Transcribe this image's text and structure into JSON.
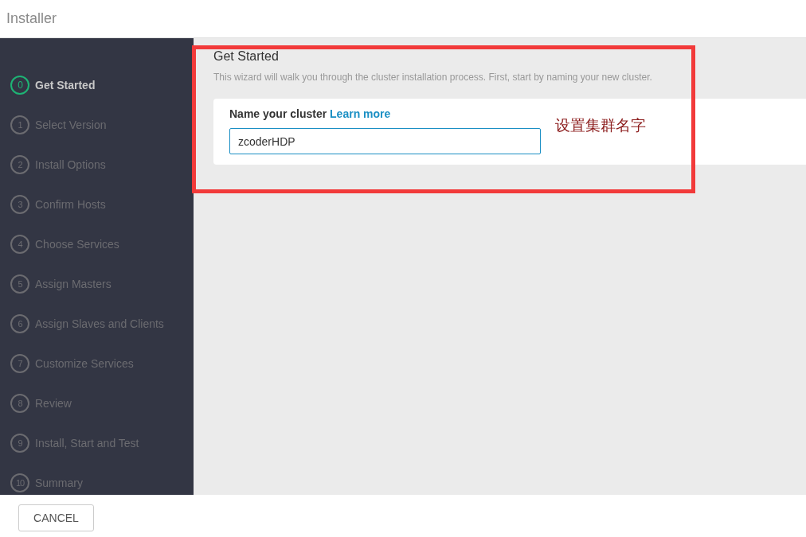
{
  "window": {
    "title": "Installer"
  },
  "steps": [
    {
      "number": "0",
      "label": "Get Started",
      "selected": true
    },
    {
      "number": "1",
      "label": "Select Version",
      "selected": false
    },
    {
      "number": "2",
      "label": "Install Options",
      "selected": false
    },
    {
      "number": "3",
      "label": "Confirm Hosts",
      "selected": false
    },
    {
      "number": "4",
      "label": "Choose Services",
      "selected": false
    },
    {
      "number": "5",
      "label": "Assign Masters",
      "selected": false
    },
    {
      "number": "6",
      "label": "Assign Slaves and Clients",
      "selected": false
    },
    {
      "number": "7",
      "label": "Customize Services",
      "selected": false
    },
    {
      "number": "8",
      "label": "Review",
      "selected": false
    },
    {
      "number": "9",
      "label": "Install, Start and Test",
      "selected": false
    },
    {
      "number": "10",
      "label": "Summary",
      "selected": false
    }
  ],
  "content": {
    "title": "Get Started",
    "description": "This wizard will walk you through the cluster installation process. First, start by naming your new cluster.",
    "field_label": "Name your cluster",
    "link": "Learn more",
    "value": "zcoderHDP"
  },
  "annotation": {
    "text": "设置集群名字"
  },
  "footer": {
    "cancel": "CANCEL"
  }
}
